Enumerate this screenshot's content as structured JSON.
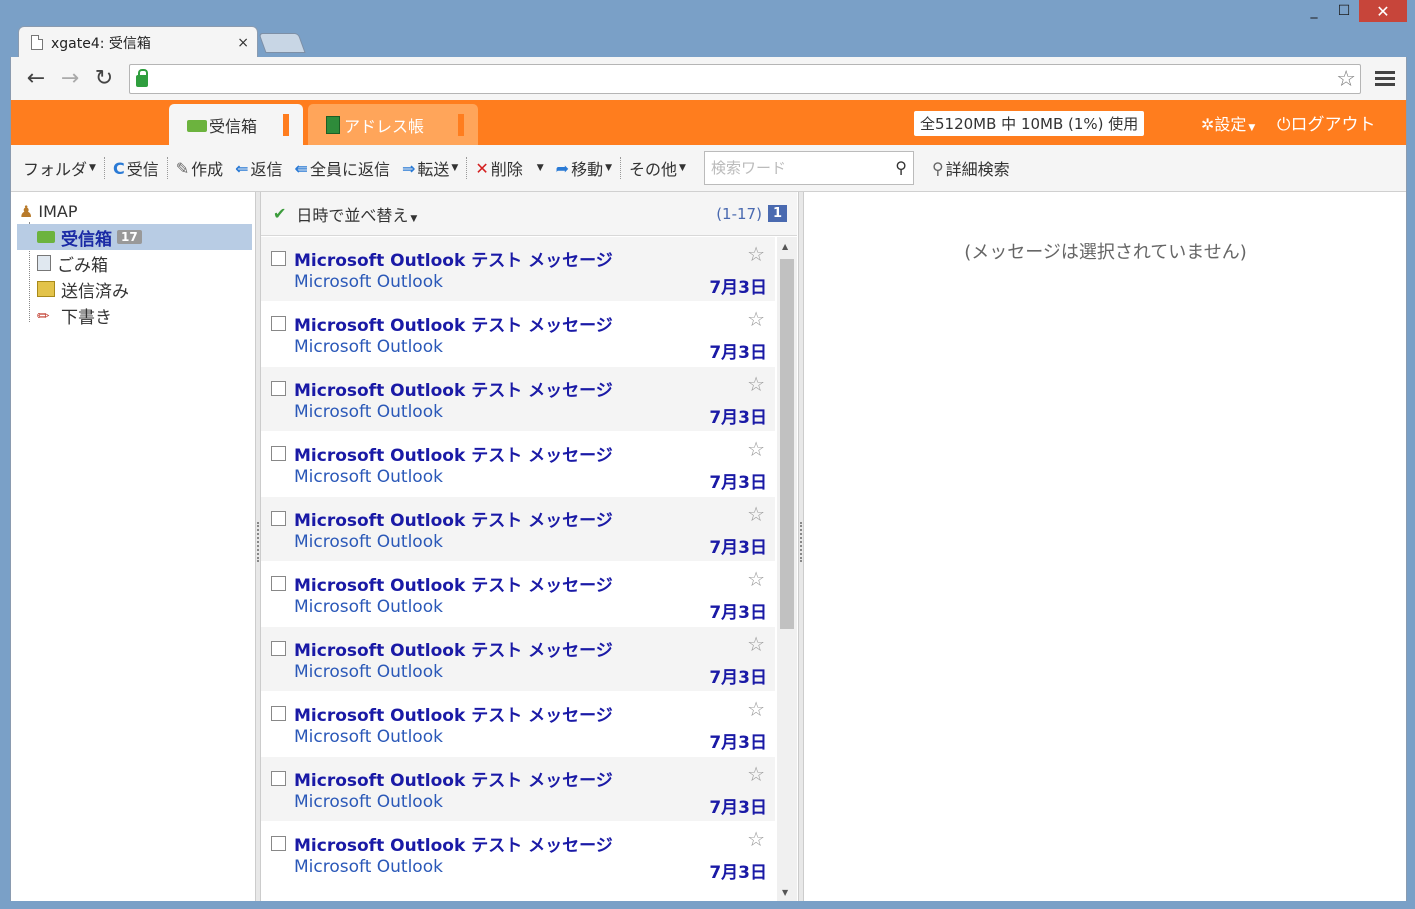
{
  "window": {
    "minimize": "_",
    "maximize": "☐",
    "close": "✕"
  },
  "browser": {
    "tab_title": "xgate4: 受信箱",
    "tab_close": "×",
    "url": ""
  },
  "app_header": {
    "tabs": [
      {
        "label": "受信箱",
        "active": true
      },
      {
        "label": "アドレス帳",
        "active": false
      }
    ],
    "usage": "全5120MB 中 10MB (1%) 使用",
    "settings": "設定",
    "logout": "ログアウト"
  },
  "command_bar": {
    "folder": "フォルダ",
    "receive": "受信",
    "compose": "作成",
    "reply": "返信",
    "reply_all": "全員に返信",
    "forward": "転送",
    "delete": "削除",
    "move": "移動",
    "other": "その他",
    "search_placeholder": "検索ワード",
    "advanced_search": "詳細検索"
  },
  "folders": {
    "account": "IMAP",
    "items": [
      {
        "label": "受信箱",
        "count": "17",
        "selected": true
      },
      {
        "label": "ごみ箱"
      },
      {
        "label": "送信済み"
      },
      {
        "label": "下書き"
      }
    ]
  },
  "message_list": {
    "sort_label": "日時で並べ替え",
    "range": "(1-17)",
    "page": "1",
    "messages": [
      {
        "subject": "Microsoft Outlook テスト メッセージ",
        "from": "Microsoft Outlook",
        "date": "7月3日"
      },
      {
        "subject": "Microsoft Outlook テスト メッセージ",
        "from": "Microsoft Outlook",
        "date": "7月3日"
      },
      {
        "subject": "Microsoft Outlook テスト メッセージ",
        "from": "Microsoft Outlook",
        "date": "7月3日"
      },
      {
        "subject": "Microsoft Outlook テスト メッセージ",
        "from": "Microsoft Outlook",
        "date": "7月3日"
      },
      {
        "subject": "Microsoft Outlook テスト メッセージ",
        "from": "Microsoft Outlook",
        "date": "7月3日"
      },
      {
        "subject": "Microsoft Outlook テスト メッセージ",
        "from": "Microsoft Outlook",
        "date": "7月3日"
      },
      {
        "subject": "Microsoft Outlook テスト メッセージ",
        "from": "Microsoft Outlook",
        "date": "7月3日"
      },
      {
        "subject": "Microsoft Outlook テスト メッセージ",
        "from": "Microsoft Outlook",
        "date": "7月3日"
      },
      {
        "subject": "Microsoft Outlook テスト メッセージ",
        "from": "Microsoft Outlook",
        "date": "7月3日"
      },
      {
        "subject": "Microsoft Outlook テスト メッセージ",
        "from": "Microsoft Outlook",
        "date": "7月3日"
      }
    ]
  },
  "preview": {
    "empty_text": "(メッセージは選択されていません)"
  },
  "colors": {
    "brand_orange": "#ff7d1e",
    "link_blue": "#1a1aa6",
    "selected_folder": "#b8cce4"
  }
}
